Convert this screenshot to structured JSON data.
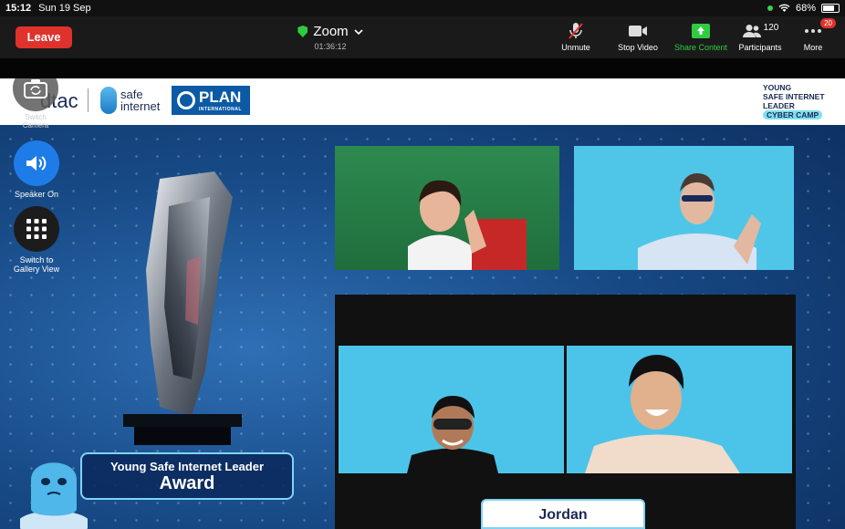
{
  "status_bar": {
    "time": "15:12",
    "date": "Sun 19 Sep",
    "battery": "68%"
  },
  "toolbar": {
    "leave_label": "Leave",
    "meeting_title": "Zoom",
    "meeting_timer": "01:36:12",
    "unmute_label": "Unmute",
    "stop_video_label": "Stop Video",
    "share_content_label": "Share Content",
    "participants_label": "Participants",
    "participants_count": "120",
    "more_label": "More",
    "more_badge": "20"
  },
  "side_controls": {
    "switch_camera_label": "Switch Camera",
    "speaker_label": "Speaker On",
    "gallery_label_line1": "Switch to",
    "gallery_label_line2": "Gallery View"
  },
  "logos": {
    "dtac": "dtac",
    "safe_line1": "safe",
    "safe_line2": "internet",
    "plan": "PLAN",
    "plan_sub": "INTERNATIONAL",
    "camp_line1": "YOUNG",
    "camp_line2": "SAFE INTERNET",
    "camp_line3": "LEADER",
    "camp_line4": "CYBER CAMP"
  },
  "award": {
    "subtitle": "Young Safe Internet Leader",
    "title": "Award"
  },
  "speaker_name": "Jordan",
  "colors": {
    "leave": "#e0322d",
    "share": "#2ecc40",
    "speaker_button": "#1e7ce8",
    "stage": "#174a86"
  }
}
